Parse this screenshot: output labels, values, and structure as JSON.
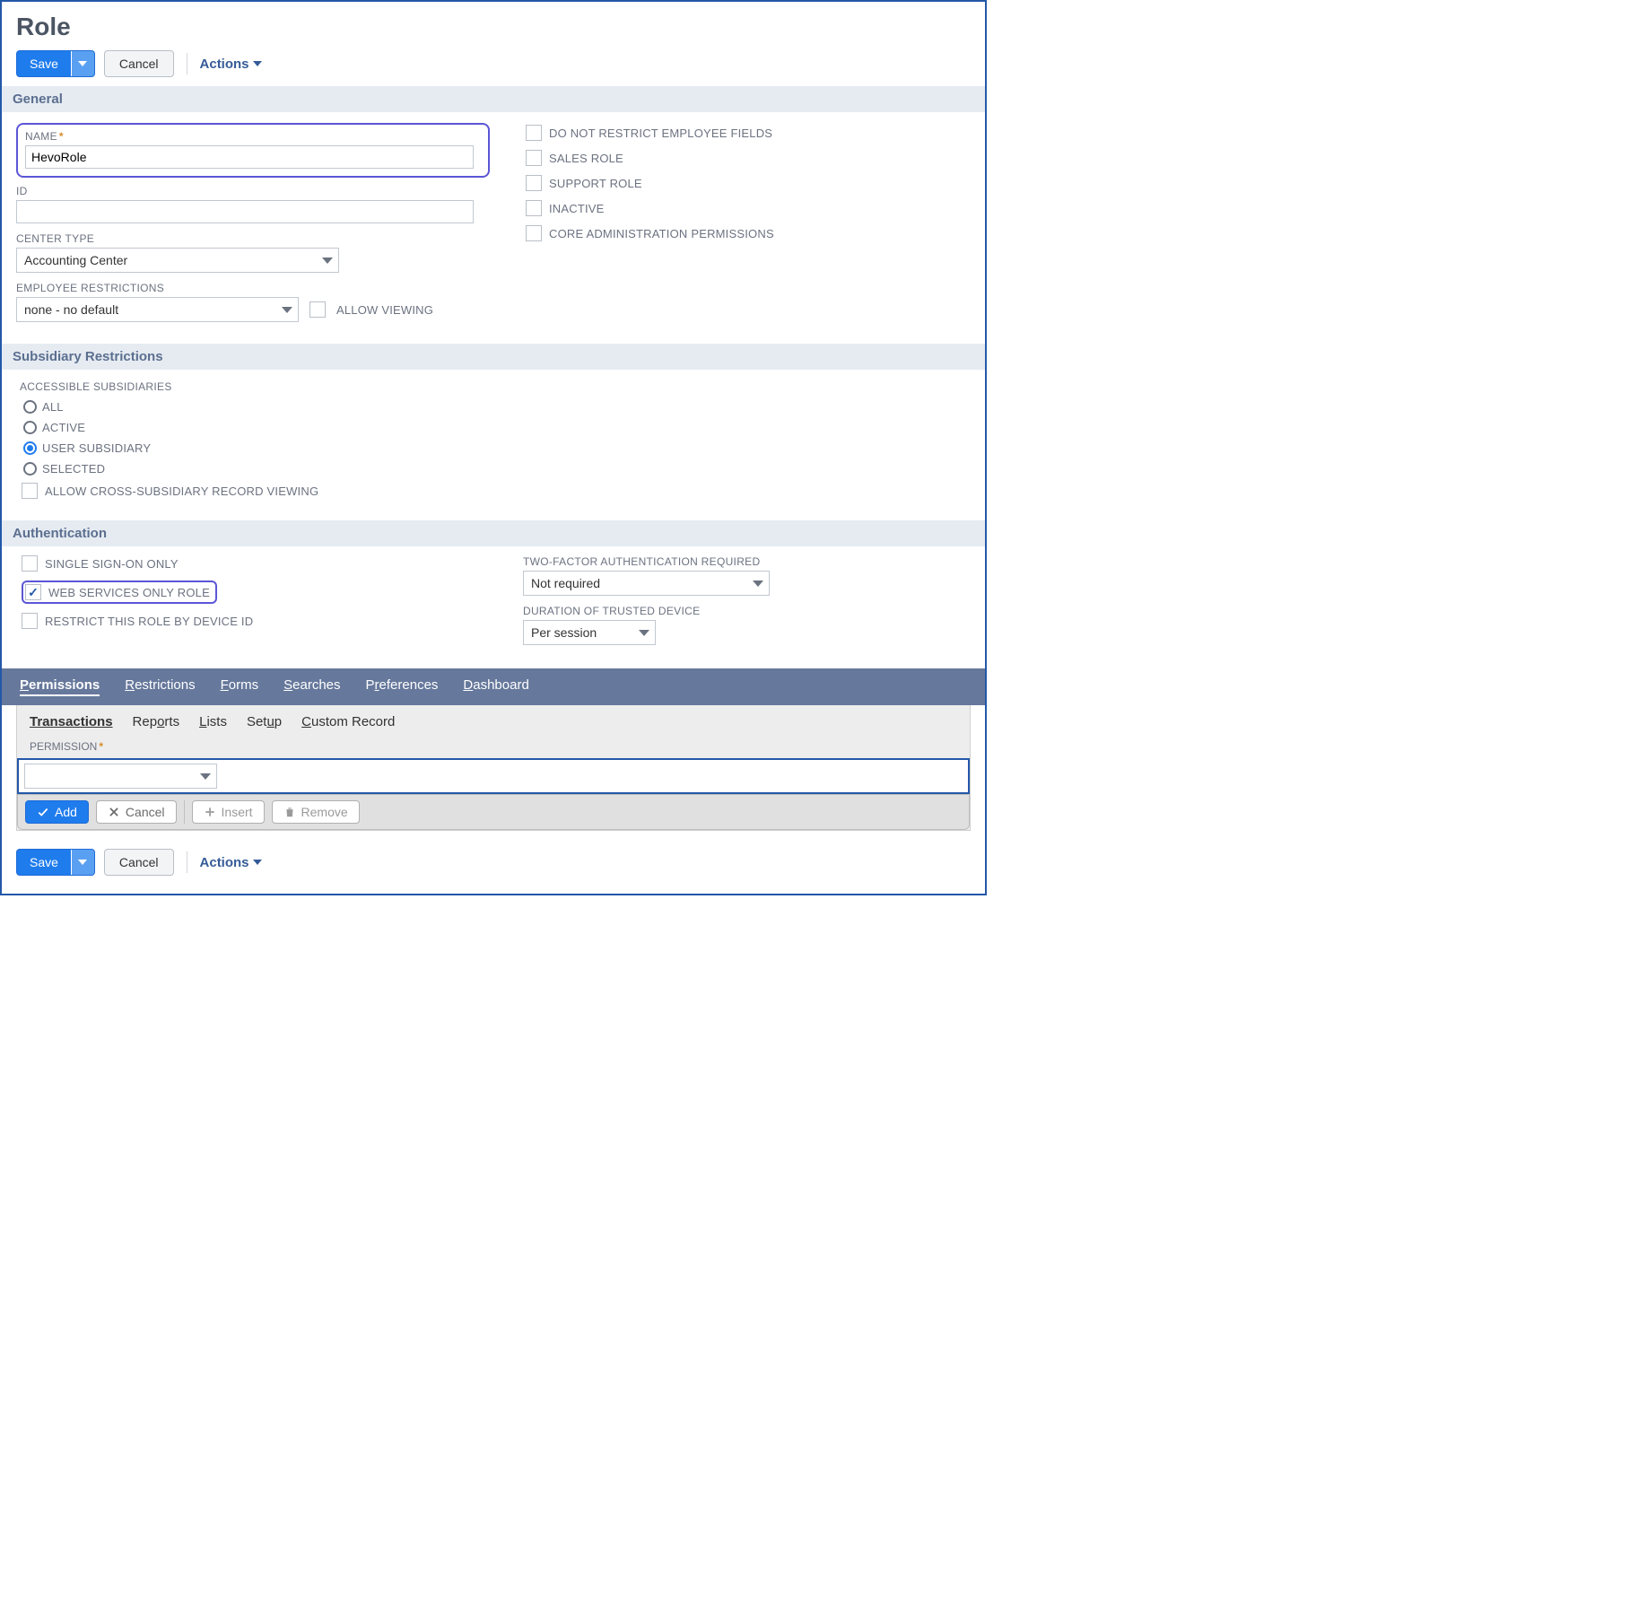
{
  "header": {
    "title": "Role",
    "save_label": "Save",
    "cancel_label": "Cancel",
    "actions_label": "Actions"
  },
  "sections": {
    "general_title": "General",
    "subsidiary_title": "Subsidiary Restrictions",
    "authentication_title": "Authentication"
  },
  "general": {
    "name_label": "NAME",
    "name_value": "HevoRole",
    "id_label": "ID",
    "id_value": "",
    "center_type_label": "CENTER TYPE",
    "center_type_value": "Accounting Center",
    "emp_restrictions_label": "EMPLOYEE RESTRICTIONS",
    "emp_restrictions_value": "none - no default",
    "allow_viewing_label": "ALLOW VIEWING",
    "right_checks": {
      "no_restrict_emp_fields": "DO NOT RESTRICT EMPLOYEE FIELDS",
      "sales_role": "SALES ROLE",
      "support_role": "SUPPORT ROLE",
      "inactive": "INACTIVE",
      "core_admin": "CORE ADMINISTRATION PERMISSIONS"
    }
  },
  "subsidiary": {
    "accessible_label": "ACCESSIBLE SUBSIDIARIES",
    "options": {
      "all": "ALL",
      "active": "ACTIVE",
      "user_sub": "USER SUBSIDIARY",
      "selected": "SELECTED"
    },
    "selected_value": "user_sub",
    "allow_cross_label": "ALLOW CROSS-SUBSIDIARY RECORD VIEWING"
  },
  "authentication": {
    "sso_label": "SINGLE SIGN-ON ONLY",
    "web_services_label": "WEB SERVICES ONLY ROLE",
    "web_services_checked": true,
    "restrict_device_label": "RESTRICT THIS ROLE BY DEVICE ID",
    "tfa_label": "TWO-FACTOR AUTHENTICATION REQUIRED",
    "tfa_value": "Not required",
    "trusted_duration_label": "DURATION OF TRUSTED DEVICE",
    "trusted_duration_value": "Per session"
  },
  "tabs_primary": {
    "permissions": "Permissions",
    "restrictions": "Restrictions",
    "forms": "Forms",
    "searches": "Searches",
    "preferences": "Preferences",
    "dashboard": "Dashboard"
  },
  "tabs_secondary": {
    "transactions": "Transactions",
    "reports": "Reports",
    "lists": "Lists",
    "setup": "Setup",
    "custom_record": "Custom Record"
  },
  "permissions": {
    "permission_label": "PERMISSION",
    "permission_value": "",
    "add_label": "Add",
    "cancel_label": "Cancel",
    "insert_label": "Insert",
    "remove_label": "Remove"
  },
  "footer": {
    "save_label": "Save",
    "cancel_label": "Cancel",
    "actions_label": "Actions"
  }
}
